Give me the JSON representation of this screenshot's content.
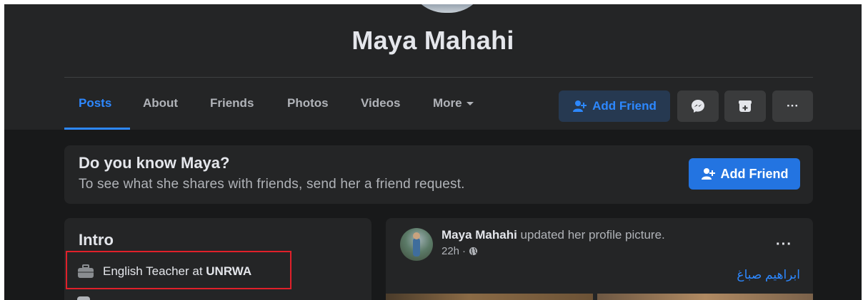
{
  "profile": {
    "name": "Maya Mahahi"
  },
  "tabs": [
    {
      "label": "Posts",
      "active": true
    },
    {
      "label": "About"
    },
    {
      "label": "Friends"
    },
    {
      "label": "Photos"
    },
    {
      "label": "Videos"
    },
    {
      "label": "More"
    }
  ],
  "actions": {
    "add_friend_label": "Add Friend",
    "messenger_icon": "messenger-icon",
    "follow_icon": "follow-icon",
    "more_label": "···"
  },
  "know_card": {
    "title": "Do you know Maya?",
    "subtitle": "To see what she shares with friends, send her a friend request.",
    "button_label": "Add Friend"
  },
  "intro": {
    "title": "Intro",
    "work_prefix": "English Teacher at ",
    "work_org": "UNRWA",
    "icon": "briefcase-icon"
  },
  "post": {
    "author": "Maya Mahahi",
    "action": " updated her profile picture.",
    "time": "22h",
    "separator": "·",
    "privacy_icon": "globe-icon",
    "menu_label": "···",
    "tagged_name": "ابراهيم صباغ"
  },
  "colors": {
    "accent": "#2d88ff",
    "button_primary": "#2374e1",
    "highlight": "#e0202a",
    "background": "#18191a",
    "card": "#242526"
  }
}
